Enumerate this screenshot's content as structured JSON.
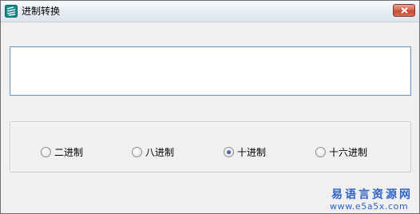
{
  "window": {
    "title": "进制转换",
    "icon": "app-icon",
    "close_icon": "close-icon"
  },
  "input": {
    "value": ""
  },
  "radix_group": {
    "options": [
      {
        "label": "二进制",
        "checked": false
      },
      {
        "label": "八进制",
        "checked": false
      },
      {
        "label": "十进制",
        "checked": true
      },
      {
        "label": "十六进制",
        "checked": false
      }
    ]
  },
  "watermark": {
    "site_name": "易语言资源网",
    "url": "www.e5a5x.com"
  },
  "colors": {
    "watermark": "#2f63c8",
    "close_button": "#c24a32"
  }
}
